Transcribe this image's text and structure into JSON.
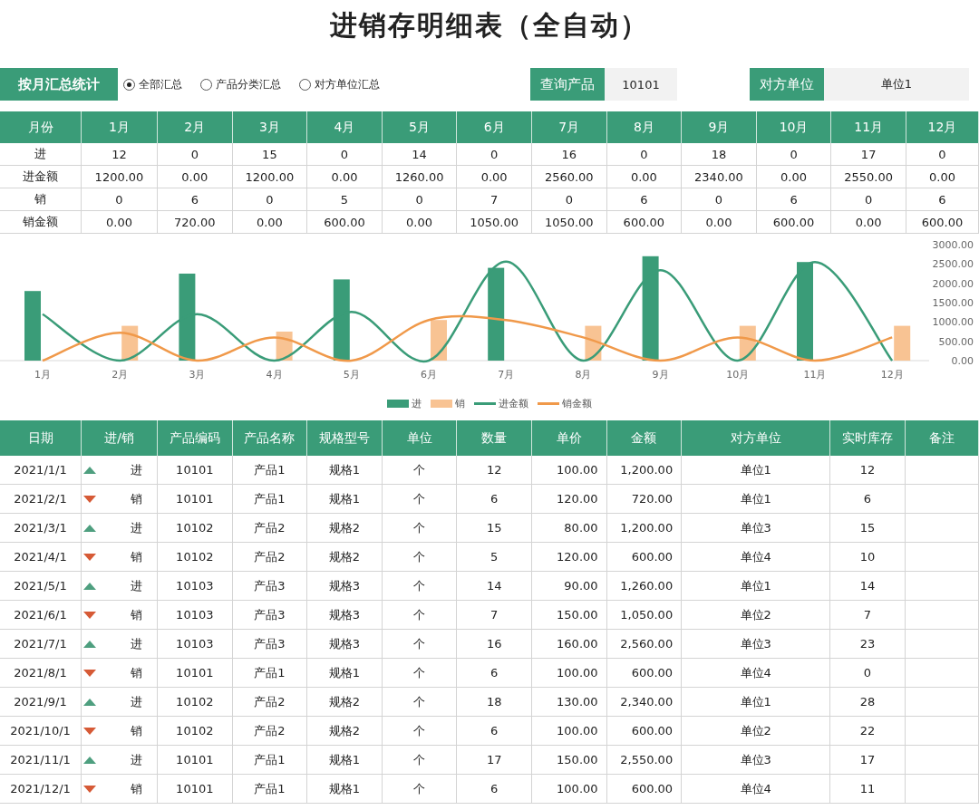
{
  "title": "进销存明细表（全自动）",
  "controls": {
    "summary_button": "按月汇总统计",
    "radios": [
      {
        "label": "全部汇总",
        "selected": true
      },
      {
        "label": "产品分类汇总",
        "selected": false
      },
      {
        "label": "对方单位汇总",
        "selected": false
      }
    ],
    "product_query": {
      "label": "查询产品",
      "value": "10101"
    },
    "partner_query": {
      "label": "对方单位",
      "value": "单位1"
    }
  },
  "monthly_table": {
    "columns": [
      "月份",
      "1月",
      "2月",
      "3月",
      "4月",
      "5月",
      "6月",
      "7月",
      "8月",
      "9月",
      "10月",
      "11月",
      "12月"
    ],
    "rows": [
      {
        "label": "进",
        "values": [
          "12",
          "0",
          "15",
          "0",
          "14",
          "0",
          "16",
          "0",
          "18",
          "0",
          "17",
          "0"
        ]
      },
      {
        "label": "进金额",
        "values": [
          "1200.00",
          "0.00",
          "1200.00",
          "0.00",
          "1260.00",
          "0.00",
          "2560.00",
          "0.00",
          "2340.00",
          "0.00",
          "2550.00",
          "0.00"
        ]
      },
      {
        "label": "销",
        "values": [
          "0",
          "6",
          "0",
          "5",
          "0",
          "7",
          "0",
          "6",
          "0",
          "6",
          "0",
          "6"
        ]
      },
      {
        "label": "销金额",
        "values": [
          "0.00",
          "720.00",
          "0.00",
          "600.00",
          "0.00",
          "1050.00",
          "1050.00",
          "600.00",
          "0.00",
          "600.00",
          "0.00",
          "600.00"
        ]
      }
    ]
  },
  "chart_data": {
    "type": "bar",
    "categories": [
      "1月",
      "2月",
      "3月",
      "4月",
      "5月",
      "6月",
      "7月",
      "8月",
      "9月",
      "10月",
      "11月",
      "12月"
    ],
    "ylim": [
      0,
      3000
    ],
    "legend": true,
    "yticks": [
      {
        "value": 0,
        "label": "0.00"
      },
      {
        "value": 500,
        "label": "500.00"
      },
      {
        "value": 1000,
        "label": "1000.00"
      },
      {
        "value": 1500,
        "label": "1500.00"
      },
      {
        "value": 2000,
        "label": "2000.00"
      },
      {
        "value": 2500,
        "label": "2500.00"
      },
      {
        "value": 3000,
        "label": "3000.00"
      }
    ],
    "series": [
      {
        "name": "进",
        "type": "bar",
        "color": "#3a9c78",
        "values": [
          1800,
          0,
          2250,
          0,
          2100,
          0,
          2400,
          0,
          2700,
          0,
          2550,
          0
        ]
      },
      {
        "name": "销",
        "type": "bar",
        "color": "#f8c393",
        "values": [
          0,
          900,
          0,
          750,
          0,
          1050,
          0,
          900,
          0,
          900,
          0,
          900
        ]
      },
      {
        "name": "进金额",
        "type": "line",
        "color": "#3a9c78",
        "values": [
          1200,
          0,
          1200,
          0,
          1260,
          0,
          2560,
          0,
          2340,
          0,
          2550,
          0
        ]
      },
      {
        "name": "销金额",
        "type": "line",
        "color": "#f0994a",
        "values": [
          0,
          720,
          0,
          600,
          0,
          1050,
          1050,
          600,
          0,
          600,
          0,
          600
        ]
      }
    ]
  },
  "detail_table": {
    "columns": [
      "日期",
      "进/销",
      "产品编码",
      "产品名称",
      "规格型号",
      "单位",
      "数量",
      "单价",
      "金额",
      "对方单位",
      "实时库存",
      "备注"
    ],
    "rows": [
      {
        "kind": "in",
        "cells": [
          "2021/1/1",
          "进",
          "10101",
          "产品1",
          "规格1",
          "个",
          "12",
          "100.00",
          "1,200.00",
          "单位1",
          "12"
        ]
      },
      {
        "kind": "out",
        "cells": [
          "2021/2/1",
          "销",
          "10101",
          "产品1",
          "规格1",
          "个",
          "6",
          "120.00",
          "720.00",
          "单位1",
          "6"
        ]
      },
      {
        "kind": "in",
        "cells": [
          "2021/3/1",
          "进",
          "10102",
          "产品2",
          "规格2",
          "个",
          "15",
          "80.00",
          "1,200.00",
          "单位3",
          "15"
        ]
      },
      {
        "kind": "out",
        "cells": [
          "2021/4/1",
          "销",
          "10102",
          "产品2",
          "规格2",
          "个",
          "5",
          "120.00",
          "600.00",
          "单位4",
          "10"
        ]
      },
      {
        "kind": "in",
        "cells": [
          "2021/5/1",
          "进",
          "10103",
          "产品3",
          "规格3",
          "个",
          "14",
          "90.00",
          "1,260.00",
          "单位1",
          "14"
        ]
      },
      {
        "kind": "out",
        "cells": [
          "2021/6/1",
          "销",
          "10103",
          "产品3",
          "规格3",
          "个",
          "7",
          "150.00",
          "1,050.00",
          "单位2",
          "7"
        ]
      },
      {
        "kind": "in",
        "cells": [
          "2021/7/1",
          "进",
          "10103",
          "产品3",
          "规格3",
          "个",
          "16",
          "160.00",
          "2,560.00",
          "单位3",
          "23"
        ]
      },
      {
        "kind": "out",
        "cells": [
          "2021/8/1",
          "销",
          "10101",
          "产品1",
          "规格1",
          "个",
          "6",
          "100.00",
          "600.00",
          "单位4",
          "0"
        ]
      },
      {
        "kind": "in",
        "cells": [
          "2021/9/1",
          "进",
          "10102",
          "产品2",
          "规格2",
          "个",
          "18",
          "130.00",
          "2,340.00",
          "单位1",
          "28"
        ]
      },
      {
        "kind": "out",
        "cells": [
          "2021/10/1",
          "销",
          "10102",
          "产品2",
          "规格2",
          "个",
          "6",
          "100.00",
          "600.00",
          "单位2",
          "22"
        ]
      },
      {
        "kind": "in",
        "cells": [
          "2021/11/1",
          "进",
          "10101",
          "产品1",
          "规格1",
          "个",
          "17",
          "150.00",
          "2,550.00",
          "单位3",
          "17"
        ]
      },
      {
        "kind": "out",
        "cells": [
          "2021/12/1",
          "销",
          "10101",
          "产品1",
          "规格1",
          "个",
          "6",
          "100.00",
          "600.00",
          "单位4",
          "11"
        ]
      }
    ]
  }
}
